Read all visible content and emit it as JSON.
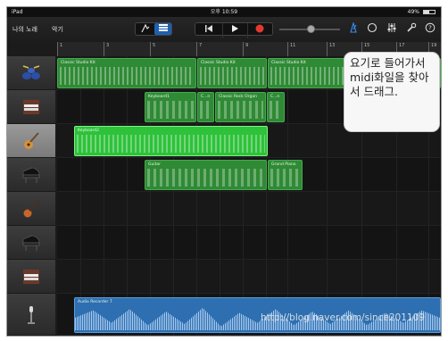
{
  "status": {
    "device": "iPad",
    "time": "오후 10:59",
    "battery": "49%"
  },
  "toolbar": {
    "my_songs": "나의 노래",
    "instruments": "악기"
  },
  "ruler": {
    "bars": [
      "1",
      "3",
      "5",
      "7",
      "9",
      "11",
      "13",
      "15",
      "17",
      "19"
    ]
  },
  "tracks": [
    {
      "icon": "drum-kit-icon",
      "selected": false
    },
    {
      "icon": "organ-icon",
      "selected": false
    },
    {
      "icon": "guitar-icon",
      "selected": true
    },
    {
      "icon": "grand-piano-icon",
      "selected": false
    },
    {
      "icon": "bass-guitar-icon",
      "selected": false
    },
    {
      "icon": "grand-piano-icon",
      "selected": false
    },
    {
      "icon": "organ-icon",
      "selected": false
    },
    {
      "icon": "microphone-icon",
      "selected": false
    }
  ],
  "regions": {
    "r0a": "Classic Studio Kit",
    "r0b": "Classic Studio Kit",
    "r0c": "Classic Studio Kit",
    "r1a": "Keyboard1",
    "r1b": "C...n",
    "r1c": "Classic Rock Organ",
    "r1d": "C...n",
    "r2a": "Keyboard2",
    "r3a": "Guitar",
    "r3b": "Grand Piano",
    "r7a": "Audio Recorder 7"
  },
  "callout": {
    "text": "요기로 들어가서 midi화일을 찾아서 드래그."
  },
  "watermark": "http://blog.naver.com/since201109",
  "colors": {
    "midi_region": "#2f8a35",
    "selected_region": "#2ec23a",
    "audio_region": "#2d6fb0",
    "record": "#e03a2e"
  }
}
